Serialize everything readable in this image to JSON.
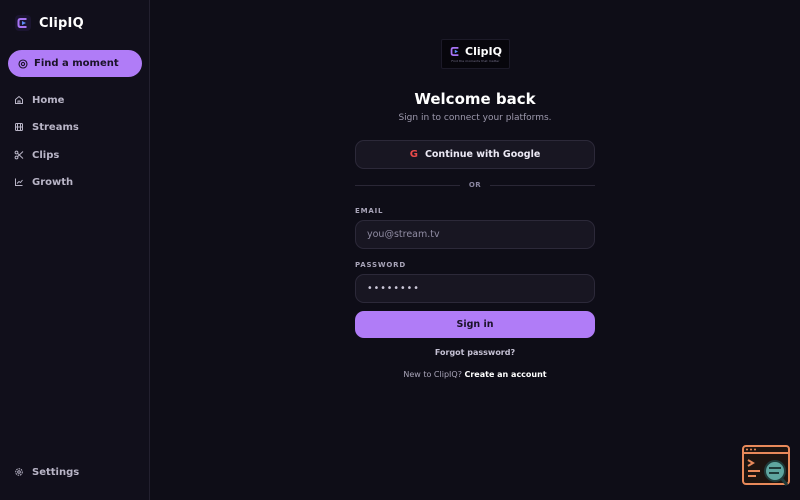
{
  "app": {
    "name": "ClipIQ"
  },
  "sidebar": {
    "cta_label": "Find a moment",
    "items": [
      {
        "label": "Home",
        "icon": "home-icon"
      },
      {
        "label": "Streams",
        "icon": "streams-icon"
      },
      {
        "label": "Clips",
        "icon": "scissors-icon"
      },
      {
        "label": "Growth",
        "icon": "chart-icon"
      }
    ],
    "settings_label": "Settings"
  },
  "login": {
    "logo_word": "ClipIQ",
    "logo_tagline": "Find the moments that matter",
    "title": "Welcome back",
    "subtitle": "Sign in to connect your platforms.",
    "google_icon": "G",
    "google_label": "Continue with Google",
    "divider_text": "OR",
    "email_label": "EMAIL",
    "email_placeholder": "you@stream.tv",
    "password_label": "PASSWORD",
    "password_value": "••••••••",
    "signin_label": "Sign in",
    "forgot_label": "Forgot password?",
    "signup_prompt": "New to ClipIQ?",
    "signup_link": "Create an account"
  },
  "colors": {
    "background": "#0e0d17",
    "sidebar": "#110f1b",
    "accent": "#b07cf7",
    "google_red": "#ea4a4a"
  }
}
